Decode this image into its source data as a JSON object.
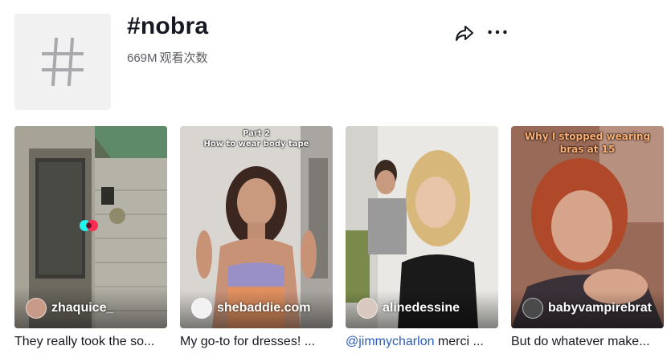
{
  "header": {
    "title": "#nobra",
    "views_count": "669M",
    "views_label": "观看次数"
  },
  "videos": [
    {
      "author": "zhaquice_",
      "caption": "They really took the so..."
    },
    {
      "author": "shebaddie.com",
      "caption": "My go-to for dresses! ...",
      "overlay_line1": "Part 2",
      "overlay_line2": "How to wear body tape"
    },
    {
      "author": "alinedessine",
      "caption_mention": "@jimmycharlon",
      "caption_rest": " merci ..."
    },
    {
      "author": "babyvampirebrat",
      "caption": "But do whatever make...",
      "overlay_line1": "Why I stopped wearing",
      "overlay_line2": "bras at 15"
    }
  ],
  "colors": {
    "mention": "#2b5db9",
    "muted": "#5b5c63",
    "text": "#161823"
  }
}
